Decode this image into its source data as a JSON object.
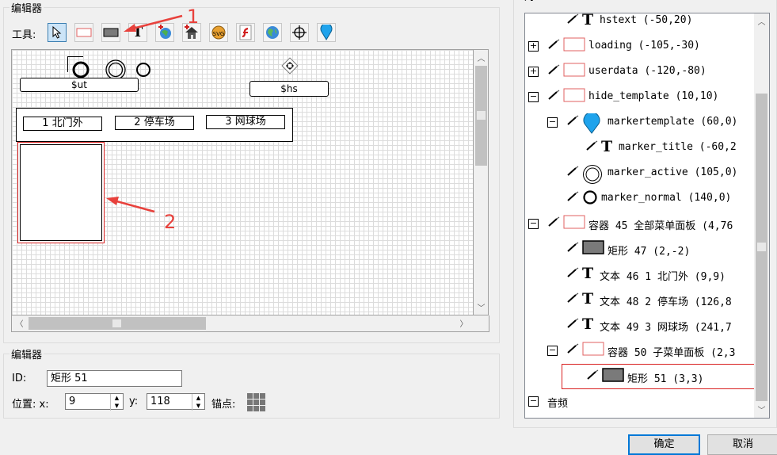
{
  "editor_group": {
    "title": "编辑器"
  },
  "tools": {
    "label": "工具:",
    "items": [
      "pointer",
      "rect-outline",
      "rect-filled",
      "text",
      "hotspot-image",
      "house",
      "svg",
      "flash",
      "globe",
      "crosshair",
      "marker-pin"
    ]
  },
  "annotations": {
    "num1": "1",
    "num2": "2"
  },
  "canvas": {
    "ut_label": "$ut",
    "hs_label": "$hs",
    "menu_items": [
      "1 北门外",
      "2 停车场",
      "3 网球场"
    ]
  },
  "props_group": {
    "title": "编辑器"
  },
  "props": {
    "id_label": "ID:",
    "id_value": "矩形 51",
    "pos_label": "位置: x:",
    "x_value": "9",
    "y_label": "y:",
    "y_value": "118",
    "anchor_label": "锚点:"
  },
  "tree_header": {
    "partial": "对"
  },
  "tree": [
    {
      "indent": 1,
      "expander": "",
      "icon": "text",
      "label": "hstext (-50,20)"
    },
    {
      "indent": 0,
      "expander": "⊞",
      "icon": "rect-red",
      "label": "loading (-105,-30)"
    },
    {
      "indent": 0,
      "expander": "⊞",
      "icon": "rect-red",
      "label": "userdata (-120,-80)"
    },
    {
      "indent": 0,
      "expander": "⊟",
      "icon": "rect-red",
      "label": "hide_template (10,10)"
    },
    {
      "indent": 1,
      "expander": "⊟",
      "icon": "pin",
      "label": "markertemplate (60,0)"
    },
    {
      "indent": 2,
      "expander": "",
      "icon": "text",
      "label": "marker_title (-60,2"
    },
    {
      "indent": 1,
      "expander": "",
      "icon": "ring-double",
      "label": "marker_active (105,0)"
    },
    {
      "indent": 1,
      "expander": "",
      "icon": "ring",
      "label": "marker_normal (140,0)"
    },
    {
      "indent": 0,
      "expander": "⊟",
      "icon": "rect-red",
      "label": "容器 45 全部菜单面板 (4,76"
    },
    {
      "indent": 1,
      "expander": "",
      "icon": "rect-gray",
      "label": "矩形 47 (2,-2)"
    },
    {
      "indent": 1,
      "expander": "",
      "icon": "text",
      "label": "文本 46 1 北门外 (9,9)"
    },
    {
      "indent": 1,
      "expander": "",
      "icon": "text",
      "label": "文本 48 2 停车场 (126,8"
    },
    {
      "indent": 1,
      "expander": "",
      "icon": "text",
      "label": "文本 49 3 网球场 (241,7"
    },
    {
      "indent": 1,
      "expander": "⊟",
      "icon": "rect-red",
      "label": "容器 50 子菜单面板 (2,3"
    },
    {
      "indent": 2,
      "expander": "",
      "icon": "rect-gray",
      "label": "矩形 51 (3,3)",
      "selected": true
    },
    {
      "indent": 0,
      "expander": "⊟",
      "icon": "none",
      "label": "音频"
    }
  ],
  "buttons": {
    "ok": "确定",
    "cancel": "取消"
  },
  "colors": {
    "accent": "#0078d7",
    "annotation": "#e8413c",
    "selection_red": "#d92020"
  }
}
